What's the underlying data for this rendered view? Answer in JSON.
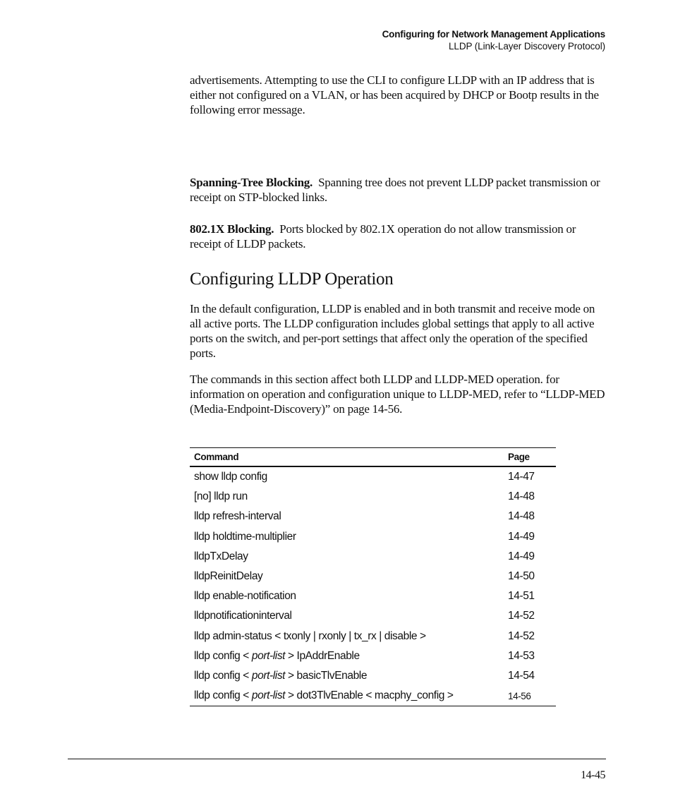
{
  "running_head": {
    "chapter_title": "Configuring for Network Management Applications",
    "section_title": "LLDP (Link-Layer Discovery Protocol)"
  },
  "body": {
    "intro_paragraph": "advertisements. Attempting to use the CLI to configure LLDP with an IP address that is either not configured on a VLAN, or has been acquired by DHCP or Bootp results in the following error message.",
    "spanning_tree": {
      "run_in": "Spanning-Tree Blocking.",
      "text": "Spanning tree does not prevent LLDP packet transmission or receipt on STP-blocked links."
    },
    "dot1x": {
      "run_in": "802.1X Blocking.",
      "text": "Ports blocked by 802.1X operation do not allow transmission or receipt of LLDP packets."
    },
    "heading": "Configuring LLDP Operation",
    "default_paragraph": "In the default configuration, LLDP is enabled and in both transmit and receive mode on all active ports. The LLDP configuration includes global settings that apply to all active ports on the switch, and per-port settings that affect only the operation of the specified ports.",
    "commands_paragraph": "The commands in this section affect both LLDP and LLDP-MED operation. for information on operation and configuration unique to LLDP-MED, refer to “LLDP-MED (Media-Endpoint-Discovery)” on page 14-56."
  },
  "command_table": {
    "headers": {
      "command": "Command",
      "page": "Page"
    },
    "rows": [
      {
        "pre": "show lldp config",
        "arg": "",
        "post": "",
        "page": "14-47"
      },
      {
        "pre": "[no] lldp run",
        "arg": "",
        "post": "",
        "page": "14-48"
      },
      {
        "pre": "lldp refresh-interval",
        "arg": "",
        "post": "",
        "page": "14-48"
      },
      {
        "pre": "lldp holdtime-multiplier",
        "arg": "",
        "post": "",
        "page": "14-49"
      },
      {
        "pre": "lldpTxDelay",
        "arg": "",
        "post": "",
        "page": "14-49"
      },
      {
        "pre": "lldpReinitDelay",
        "arg": "",
        "post": "",
        "page": "14-50"
      },
      {
        "pre": "lldp enable-notification",
        "arg": "",
        "post": "",
        "page": "14-51"
      },
      {
        "pre": "lldpnotificationinterval",
        "arg": "",
        "post": "",
        "page": "14-52"
      },
      {
        "pre": "lldp admin-status < txonly | rxonly | tx_rx | disable >",
        "arg": "",
        "post": "",
        "page": "14-52"
      },
      {
        "pre": "lldp config < ",
        "arg": "port-list",
        "post": " > IpAddrEnable",
        "page": "14-53"
      },
      {
        "pre": "lldp config < ",
        "arg": "port-list",
        "post": " > basicTlvEnable",
        "page": "14-54"
      },
      {
        "pre": "lldp config < ",
        "arg": "port-list",
        "post": " > dot3TlvEnable < macphy_config >",
        "page": "14-56"
      }
    ]
  },
  "footer": {
    "page_number": "14-45"
  }
}
